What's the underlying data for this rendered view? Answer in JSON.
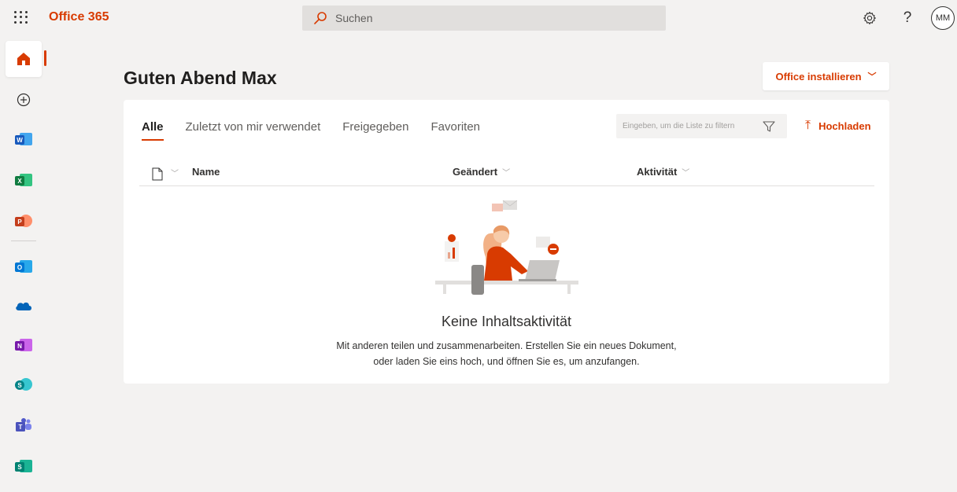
{
  "topbar": {
    "brand": "Office 365",
    "search_placeholder": "Suchen",
    "avatar_initials": "MM",
    "help_label": "?"
  },
  "colors": {
    "accent": "#d83b01",
    "word": "#185abd",
    "excel": "#107c41",
    "powerpoint": "#c43e1c",
    "outlook": "#0078d4",
    "onedrive": "#0364b8",
    "onenote": "#7719aa",
    "sharepoint": "#038387",
    "teams": "#5059c9",
    "sway": "#008272"
  },
  "rail": {
    "items": [
      {
        "name": "home",
        "icon": "home-icon",
        "letter": ""
      },
      {
        "name": "create",
        "icon": "add-circle-icon",
        "letter": ""
      },
      {
        "name": "word",
        "icon": "word-icon",
        "letter": "W"
      },
      {
        "name": "excel",
        "icon": "excel-icon",
        "letter": "X"
      },
      {
        "name": "powerpoint",
        "icon": "powerpoint-icon",
        "letter": "P"
      },
      {
        "name": "outlook",
        "icon": "outlook-icon",
        "letter": "O"
      },
      {
        "name": "onedrive",
        "icon": "onedrive-icon",
        "letter": ""
      },
      {
        "name": "onenote",
        "icon": "onenote-icon",
        "letter": "N"
      },
      {
        "name": "sharepoint",
        "icon": "sharepoint-icon",
        "letter": "S"
      },
      {
        "name": "teams",
        "icon": "teams-icon",
        "letter": ""
      },
      {
        "name": "sway",
        "icon": "sway-icon",
        "letter": "S"
      }
    ]
  },
  "main": {
    "greeting": "Guten Abend Max",
    "install_label": "Office installieren",
    "tabs": [
      {
        "label": "Alle",
        "active": true
      },
      {
        "label": "Zuletzt von mir verwendet",
        "active": false
      },
      {
        "label": "Freigegeben",
        "active": false
      },
      {
        "label": "Favoriten",
        "active": false
      }
    ],
    "filter_placeholder": "Eingeben, um die Liste zu filtern",
    "upload_label": "Hochladen",
    "columns": {
      "name": "Name",
      "modified": "Geändert",
      "activity": "Aktivität"
    },
    "empty": {
      "title": "Keine Inhaltsaktivität",
      "line1": "Mit anderen teilen und zusammenarbeiten. Erstellen Sie ein neues Dokument,",
      "line2": "oder laden Sie eins hoch, und öffnen Sie es, um anzufangen."
    }
  }
}
